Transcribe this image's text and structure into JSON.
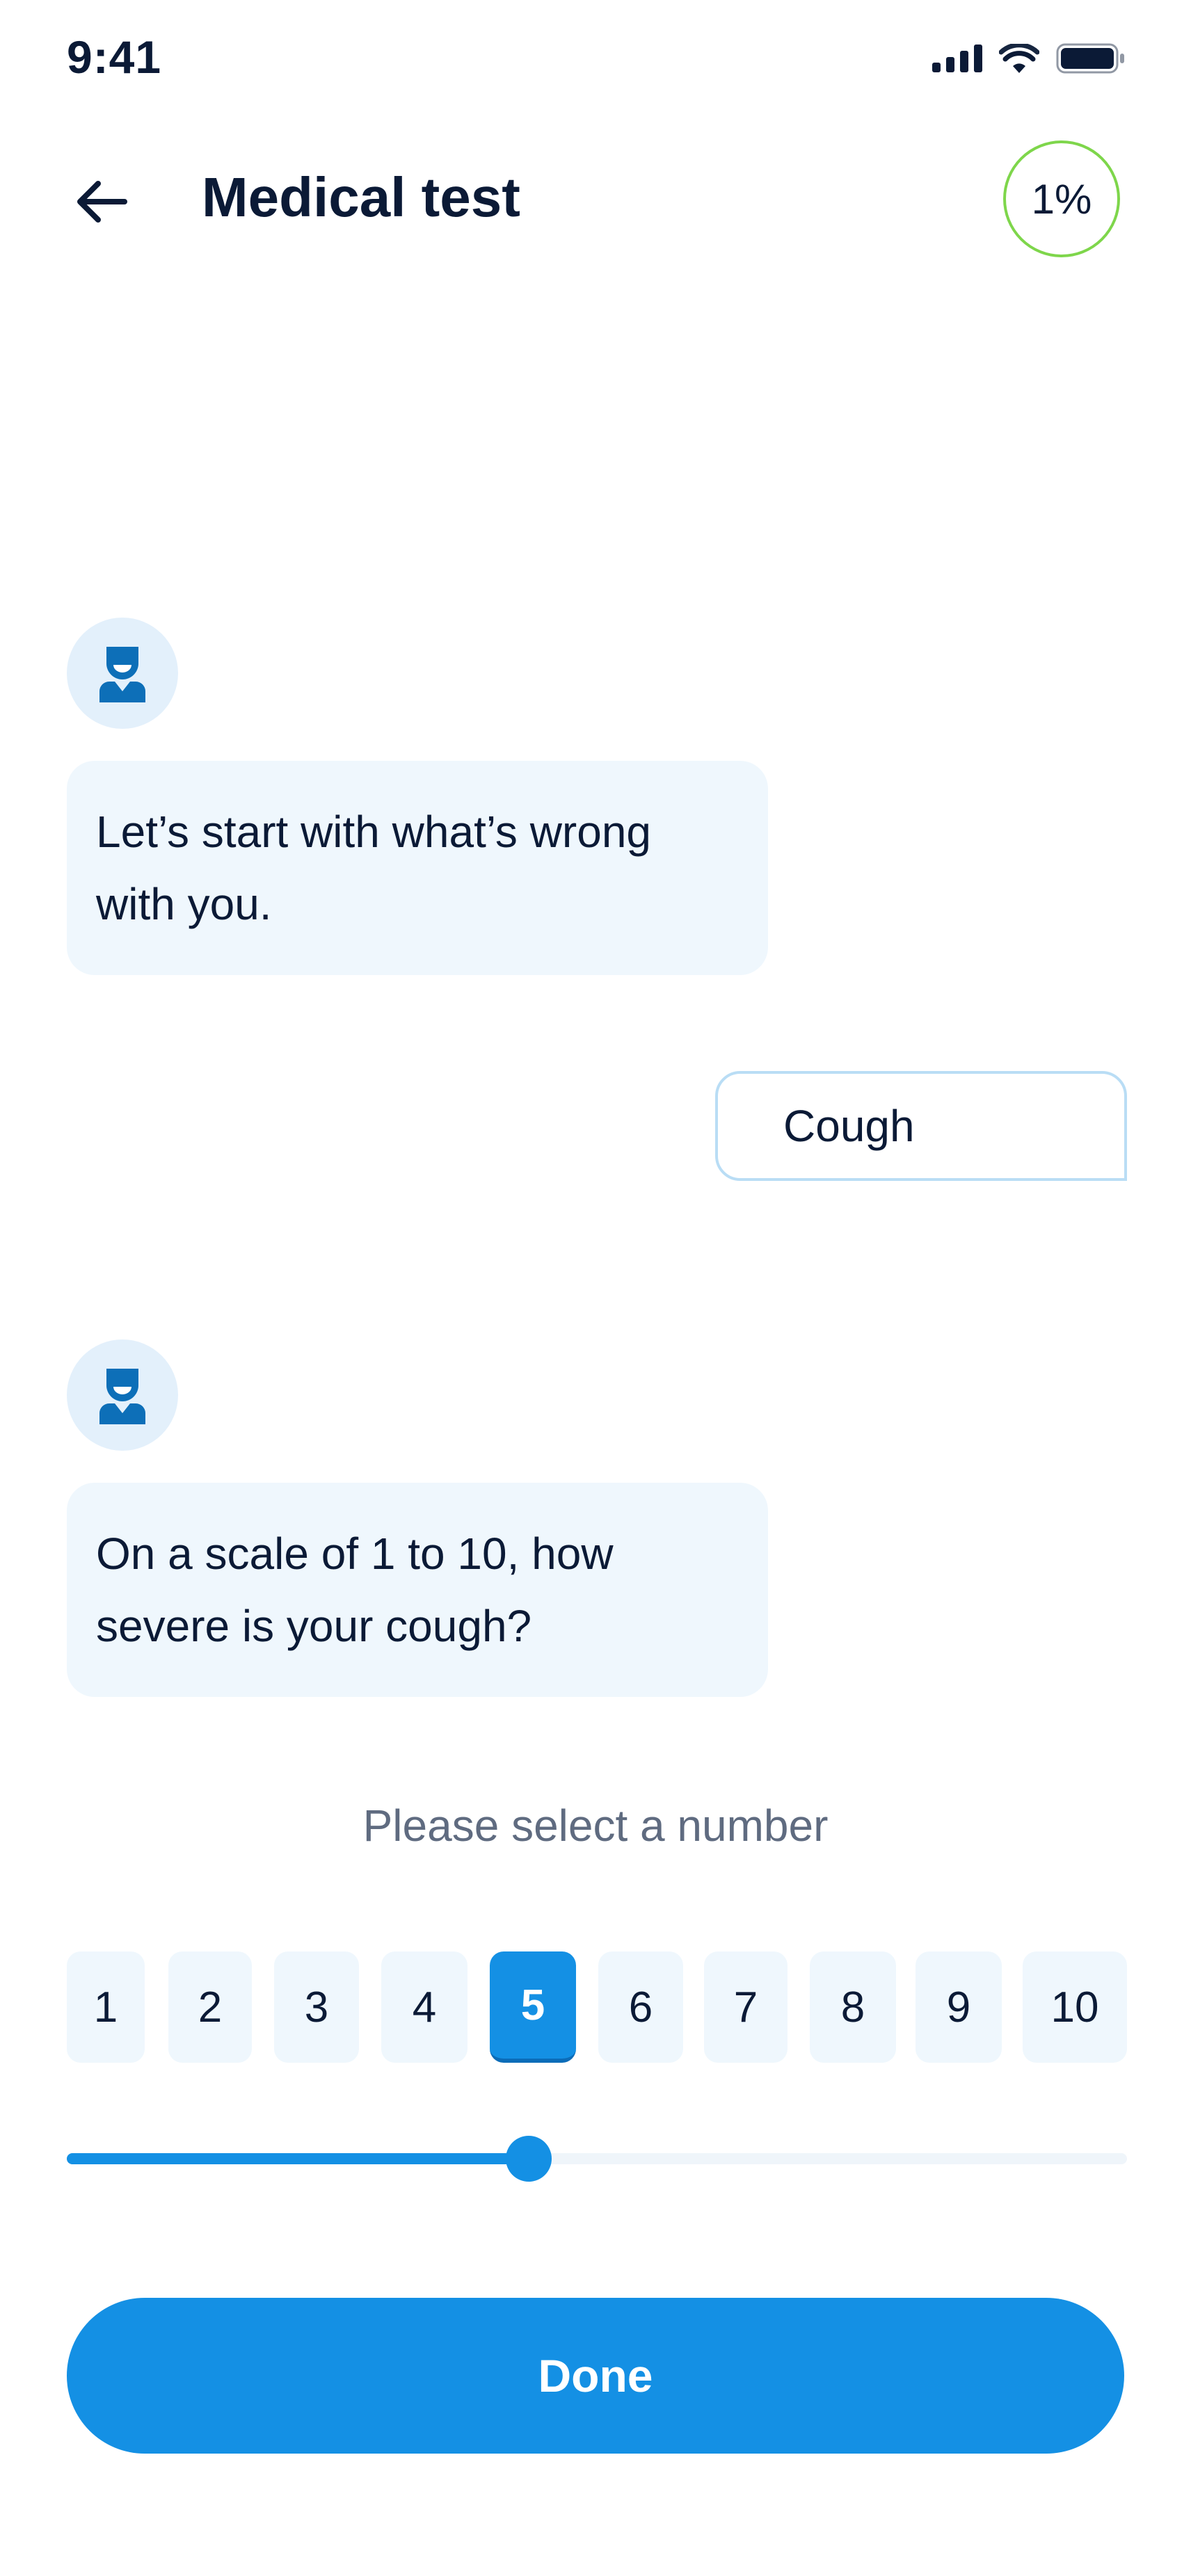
{
  "status_bar": {
    "time": "9:41",
    "icons": [
      "signal-icon",
      "wifi-icon",
      "battery-icon"
    ]
  },
  "header": {
    "back_icon": "arrow-left-icon",
    "title": "Medical test",
    "progress_label": "1%",
    "progress_value": 0.01,
    "progress_color": "#7ed64b"
  },
  "chat": {
    "messages": [
      {
        "sender": "bot",
        "avatar_icon": "doctor-icon",
        "text": "Let’s start with what’s wrong with you."
      },
      {
        "sender": "user",
        "text": "Cough"
      },
      {
        "sender": "bot",
        "avatar_icon": "doctor-icon",
        "text": "On a scale of 1 to 10, how severe is your cough?"
      }
    ]
  },
  "scale": {
    "prompt": "Please select a number",
    "options": [
      "1",
      "2",
      "3",
      "4",
      "5",
      "6",
      "7",
      "8",
      "9",
      "10"
    ],
    "selected": "5",
    "min": 1,
    "max": 10
  },
  "actions": {
    "done_label": "Done"
  },
  "colors": {
    "accent": "#1490e4",
    "bubble_bg": "#eff7fd",
    "avatar_bg": "#e3f0fb",
    "text_dark": "#0b1a36",
    "text_muted": "#5f6b80"
  }
}
